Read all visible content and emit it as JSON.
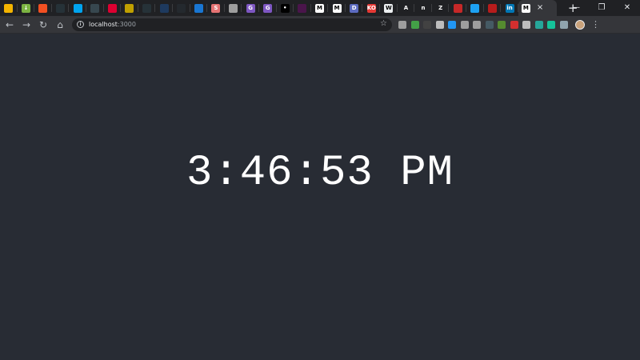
{
  "tabs": [
    {
      "icon": "chrome-icon",
      "color": "#f4b400",
      "glyph": ""
    },
    {
      "icon": "download-icon",
      "color": "#7cb342",
      "glyph": "↓"
    },
    {
      "icon": "windows-icon",
      "color": "#f25022",
      "glyph": ""
    },
    {
      "icon": "chart-icon",
      "color": "#263238",
      "glyph": ""
    },
    {
      "icon": "windows-icon",
      "color": "#00a4ef",
      "glyph": ""
    },
    {
      "icon": "grid-icon",
      "color": "#37474f",
      "glyph": ""
    },
    {
      "icon": "angular-icon",
      "color": "#dd0031",
      "glyph": ""
    },
    {
      "icon": "battery-icon",
      "color": "#c0a000",
      "glyph": ""
    },
    {
      "icon": "dark-square-icon",
      "color": "#263238",
      "glyph": ""
    },
    {
      "icon": "page-icon",
      "color": "#1e3a5f",
      "glyph": ""
    },
    {
      "icon": "github-icon",
      "color": "#24292e",
      "glyph": ""
    },
    {
      "icon": "blue-square-icon",
      "color": "#1976d2",
      "glyph": ""
    },
    {
      "icon": "s-icon",
      "color": "#e57373",
      "glyph": "S"
    },
    {
      "icon": "image-icon",
      "color": "#9e9e9e",
      "glyph": ""
    },
    {
      "icon": "g-icon",
      "color": "#7e57c2",
      "glyph": "G"
    },
    {
      "icon": "g-icon",
      "color": "#7e57c2",
      "glyph": "G"
    },
    {
      "icon": "dot-icon",
      "color": "#000000",
      "glyph": "•"
    },
    {
      "icon": "slack-icon",
      "color": "#4a154b",
      "glyph": ""
    },
    {
      "icon": "medium-icon",
      "color": "#ffffff",
      "glyph": "M"
    },
    {
      "icon": "medium-icon",
      "color": "#ffffff",
      "glyph": "M"
    },
    {
      "icon": "d-icon",
      "color": "#5c6bc0",
      "glyph": "D"
    },
    {
      "icon": "ko-icon",
      "color": "#e53935",
      "glyph": "KO"
    },
    {
      "icon": "w-icon",
      "color": "#eceff1",
      "glyph": "W"
    },
    {
      "icon": "a-icon",
      "color": "#202124",
      "glyph": "A"
    },
    {
      "icon": "n-icon",
      "color": "#202124",
      "glyph": "n"
    },
    {
      "icon": "z-icon",
      "color": "#202124",
      "glyph": "Z"
    },
    {
      "icon": "box-icon",
      "color": "#c62828",
      "glyph": ""
    },
    {
      "icon": "twitter-icon",
      "color": "#1da1f2",
      "glyph": ""
    },
    {
      "icon": "red-square-icon",
      "color": "#b71c1c",
      "glyph": ""
    },
    {
      "icon": "linkedin-icon",
      "color": "#0077b5",
      "glyph": "in"
    }
  ],
  "active_tab": {
    "icon": "medium-icon",
    "glyph": "M",
    "close": "×"
  },
  "new_tab": "+",
  "window_controls": {
    "minimize": "—",
    "restore": "❐",
    "close": "✕"
  },
  "nav": {
    "back": "←",
    "forward": "→",
    "reload": "↻",
    "home": "⌂"
  },
  "address": {
    "host": "localhost",
    "port": ":3000",
    "info": "i",
    "star": "☆"
  },
  "extensions": [
    {
      "icon": "camera-icon",
      "color": "#9e9e9e"
    },
    {
      "icon": "evernote-icon",
      "color": "#43a047"
    },
    {
      "icon": "crop-icon",
      "color": "#424242"
    },
    {
      "icon": "screen-icon",
      "color": "#bdbdbd"
    },
    {
      "icon": "blue-dot-icon",
      "color": "#2196f3"
    },
    {
      "icon": "pen-icon",
      "color": "#9e9e9e"
    },
    {
      "icon": "gear-icon",
      "color": "#9e9e9e"
    },
    {
      "icon": "b-icon",
      "color": "#455a64"
    },
    {
      "icon": "green-square-icon",
      "color": "#558b2f"
    },
    {
      "icon": "red-box-icon",
      "color": "#d32f2f"
    },
    {
      "icon": "settings-icon",
      "color": "#bdbdbd"
    },
    {
      "icon": "cast-icon",
      "color": "#26a69a"
    },
    {
      "icon": "grammarly-icon",
      "color": "#15c39a"
    },
    {
      "icon": "v-icon",
      "color": "#90a4ae"
    }
  ],
  "menu": "⋮",
  "clock": {
    "time": "3:46:53 PM"
  }
}
